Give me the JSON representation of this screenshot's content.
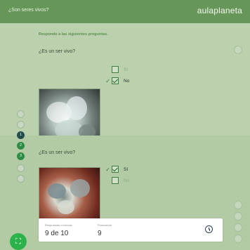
{
  "header": {
    "title": "¿Son seres vivos?",
    "logo": "aulaplaneta"
  },
  "instruction": "Responde a las siguientes preguntas.",
  "questions": [
    {
      "text": "¿Es un ser vivo?",
      "options": [
        {
          "label": "Sí",
          "checked": false
        },
        {
          "label": "No",
          "checked": true
        }
      ]
    },
    {
      "text": "¿Es un ser vivo?",
      "options": [
        {
          "label": "Sí",
          "checked": true
        },
        {
          "label": "No",
          "checked": false
        }
      ]
    }
  ],
  "nav": {
    "dots": [
      "",
      "",
      "1",
      "2",
      "3",
      "",
      ""
    ]
  },
  "score": {
    "correct_label": "Respuestas correctas",
    "correct_value": "9 de 10",
    "points_label": "Puntuación",
    "points_value": "9"
  },
  "colors": {
    "header": "#669658",
    "accent": "#2bb24a",
    "background": "#b9d0ac"
  },
  "icons": {
    "fullscreen": "fullscreen-icon",
    "timer": "clock-icon"
  }
}
